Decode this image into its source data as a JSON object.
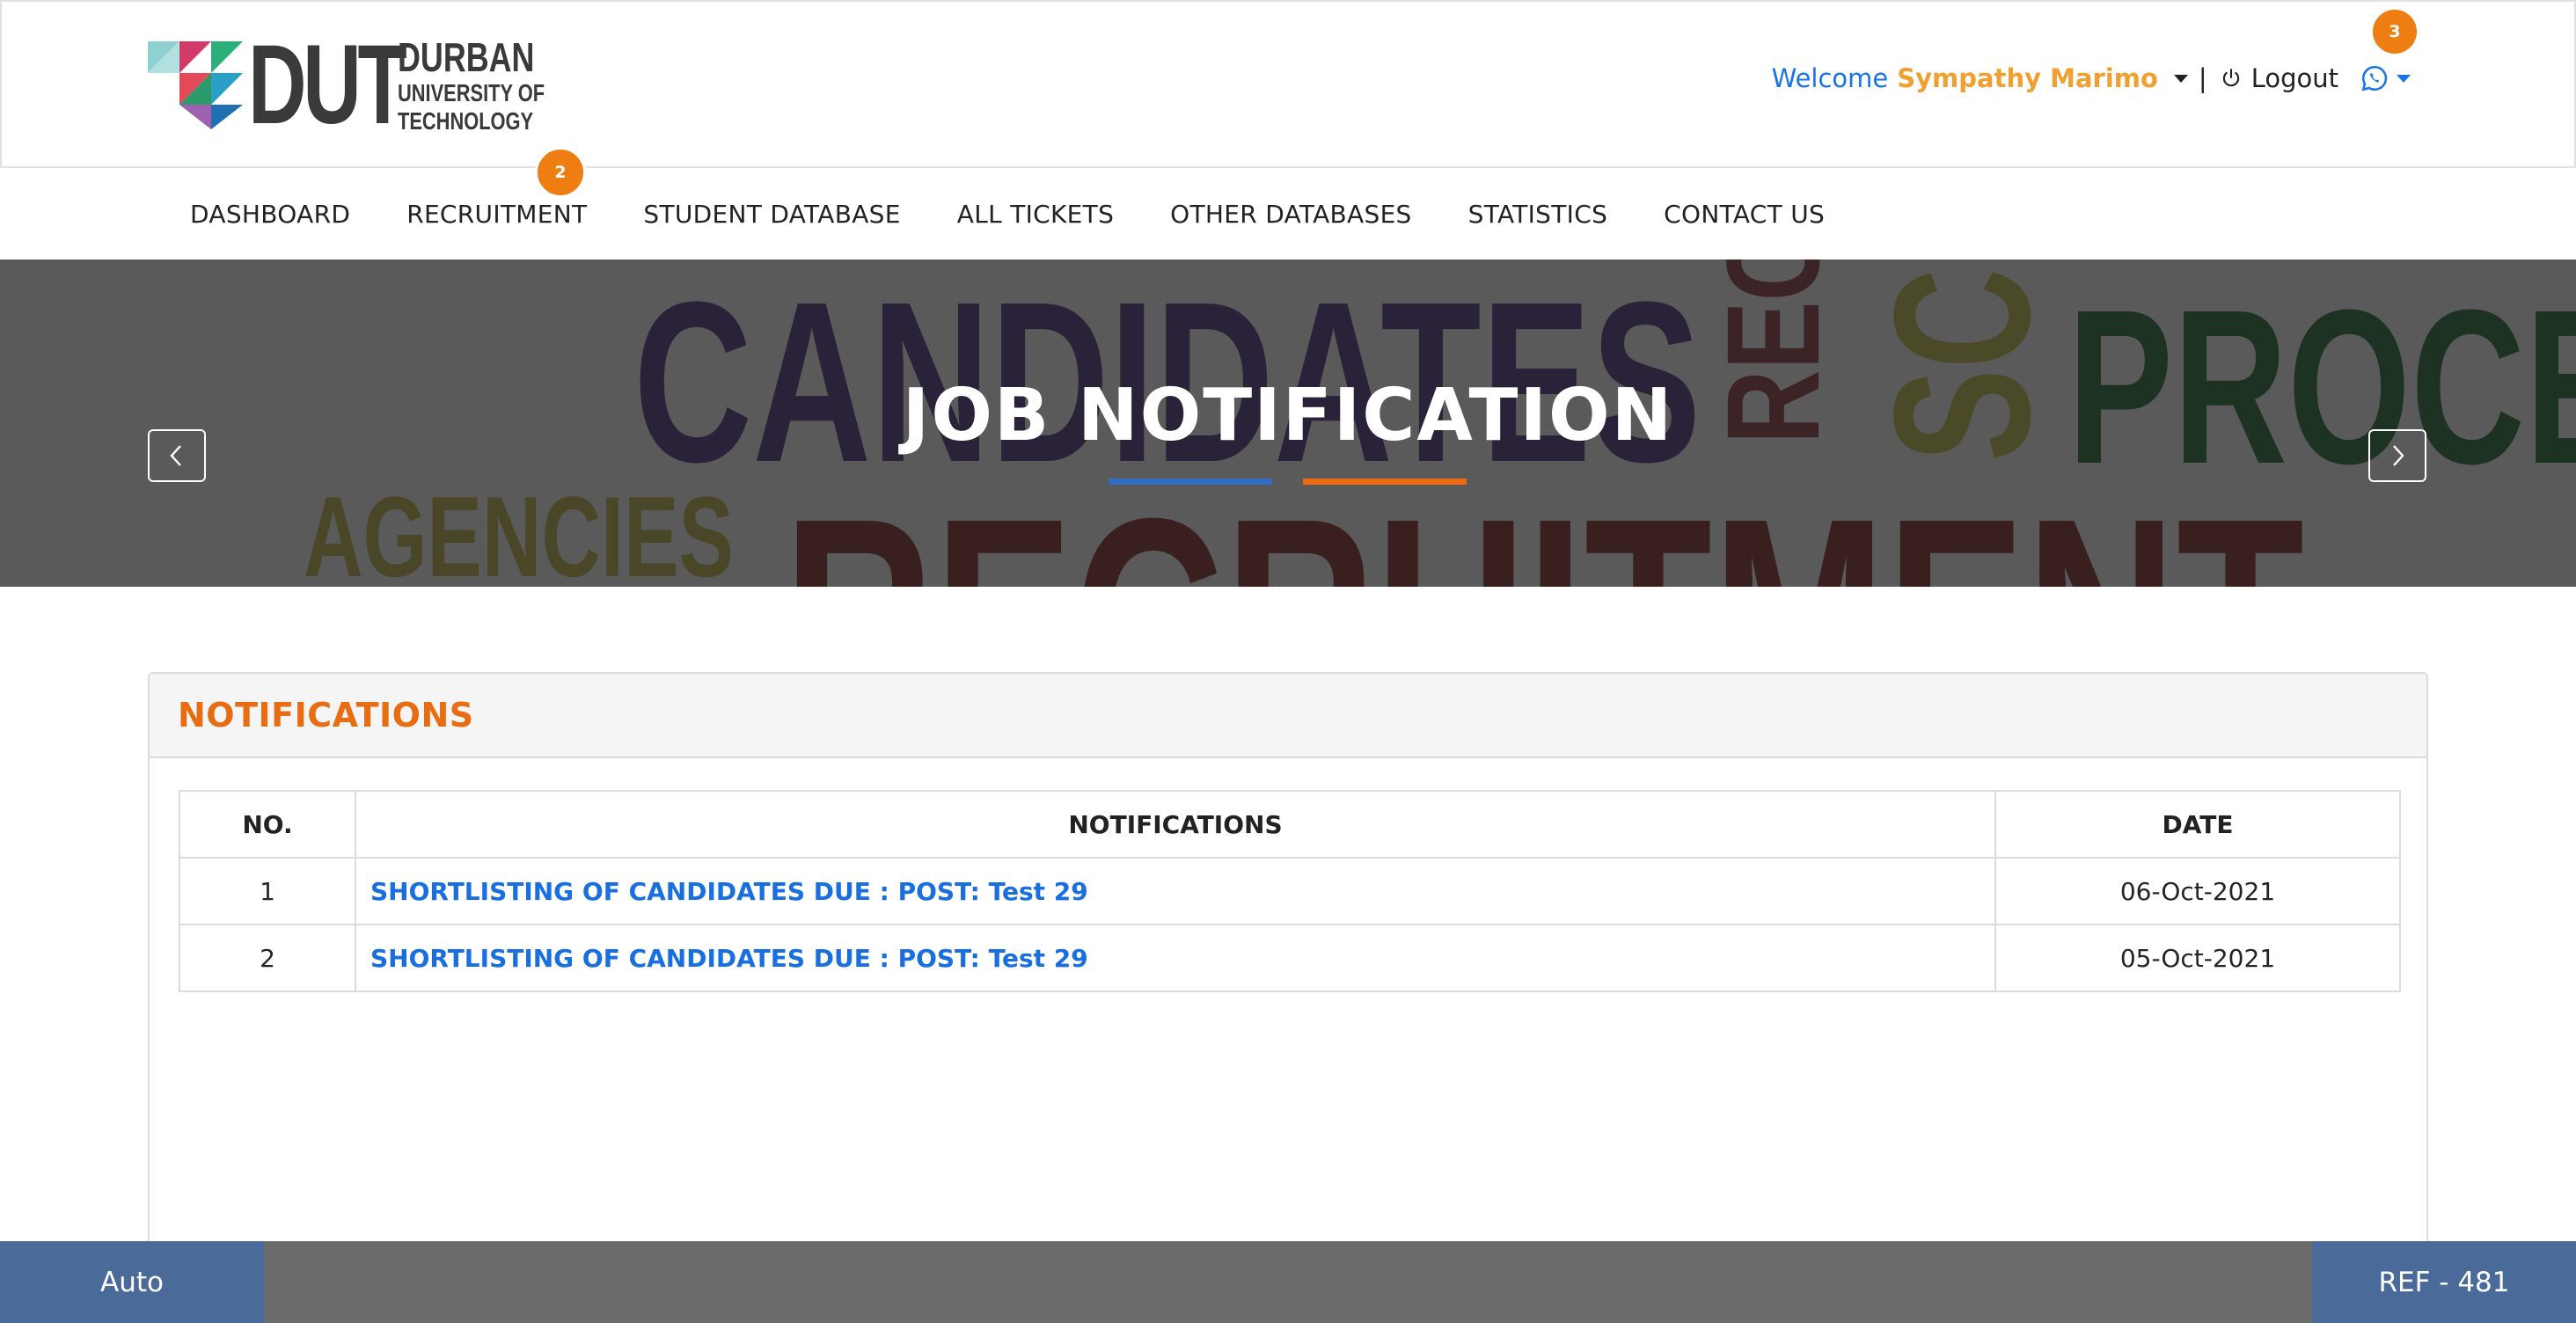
{
  "logo": {
    "mark": "DUT",
    "line1": "DURBAN",
    "line2": "UNIVERSITY OF",
    "line3": "TECHNOLOGY"
  },
  "user": {
    "welcome": "Welcome",
    "name": "Sympathy Marimo",
    "separator": "|",
    "logout": "Logout",
    "whatsapp_badge": "3"
  },
  "nav": {
    "items": [
      "DASHBOARD",
      "RECRUITMENT",
      "STUDENT DATABASE",
      "ALL TICKETS",
      "OTHER DATABASES",
      "STATISTICS",
      "CONTACT US"
    ],
    "recruitment_badge": "2"
  },
  "banner": {
    "title": "JOB NOTIFICATION",
    "background_words": [
      "CANDIDATES",
      "REC",
      "SC",
      "PROCE",
      "AGENCIES",
      "RECRUITMENT"
    ]
  },
  "notifications": {
    "title": "NOTIFICATIONS",
    "columns": [
      "NO.",
      "NOTIFICATIONS",
      "DATE"
    ],
    "rows": [
      {
        "no": "1",
        "text": "SHORTLISTING OF CANDIDATES DUE : POST: Test 29",
        "date": "06-Oct-2021"
      },
      {
        "no": "2",
        "text": "SHORTLISTING OF CANDIDATES DUE : POST: Test 29",
        "date": "05-Oct-2021"
      }
    ]
  },
  "footer": {
    "left": "Auto",
    "right": "REF - 481"
  },
  "colors": {
    "accent_orange": "#ee7e12",
    "link_blue": "#1a6fe0",
    "footer_blue": "#4a6a9a"
  }
}
